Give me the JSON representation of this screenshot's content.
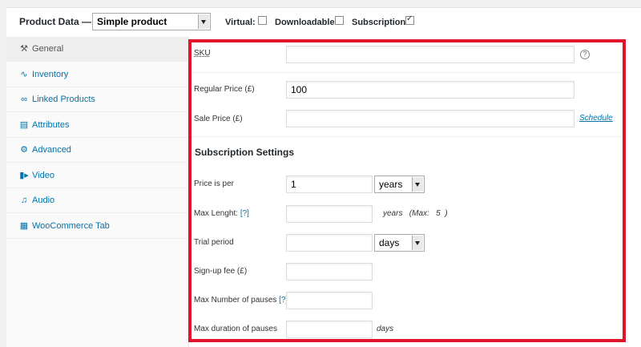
{
  "header": {
    "title": "Product Data —",
    "product_type": "Simple product",
    "virtual_label": "Virtual:",
    "virtual_checked": false,
    "downloadable_label": "Downloadable:",
    "downloadable_checked": false,
    "subscription_label": "Subscription:",
    "subscription_checked": true
  },
  "sidebar": {
    "items": [
      {
        "label": "General",
        "icon": "wrench-icon",
        "active": true
      },
      {
        "label": "Inventory",
        "icon": "chart-icon",
        "active": false
      },
      {
        "label": "Linked Products",
        "icon": "link-icon",
        "active": false
      },
      {
        "label": "Attributes",
        "icon": "list-icon",
        "active": false
      },
      {
        "label": "Advanced",
        "icon": "gear-icon",
        "active": false
      },
      {
        "label": "Video",
        "icon": "video-icon",
        "active": false
      },
      {
        "label": "Audio",
        "icon": "music-icon",
        "active": false
      },
      {
        "label": "WooCommerce Tab",
        "icon": "table-icon",
        "active": false
      }
    ]
  },
  "general": {
    "sku_label": "SKU",
    "sku_value": "",
    "regular_price_label": "Regular Price (£)",
    "regular_price_value": "100",
    "sale_price_label": "Sale Price (£)",
    "sale_price_value": "",
    "schedule_link": "Schedule"
  },
  "subscription": {
    "section_title": "Subscription Settings",
    "price_per_label": "Price is per",
    "price_per_value": "1",
    "price_per_unit": "years",
    "max_length_label": "Max Lenght:",
    "help_marker": "[?]",
    "max_length_value": "",
    "max_length_note": "years   (Max:   5  )",
    "trial_label": "Trial period",
    "trial_value": "",
    "trial_unit": "days",
    "signup_fee_label": "Sign-up fee (£)",
    "signup_fee_value": "",
    "max_pauses_label": "Max Number of pauses",
    "max_pauses_value": "",
    "max_pause_duration_label": "Max duration of pauses",
    "max_pause_duration_value": "",
    "max_pause_duration_unit": "days"
  },
  "colors": {
    "highlight": "#e0142a",
    "link": "#0073aa"
  }
}
